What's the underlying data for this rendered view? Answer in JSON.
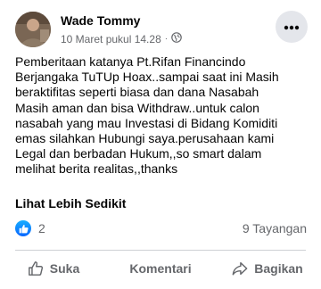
{
  "post": {
    "author": "Wade Tommy",
    "timestamp": "10 Maret pukul 14.28",
    "separator": "·",
    "audience_icon": "globe-icon",
    "more_icon": "more-dots-icon",
    "body": "Pemberitaan katanya Pt.Rifan Financindo\nBerjangaka TuTUp Hoax..sampai saat ini Masih\nberaktifitas seperti biasa dan dana Nasabah\nMasih aman dan bisa Withdraw..untuk calon\nnasabah yang mau Investasi di Bidang Komiditi\nemas silahkan Hubungi saya.perusahaan kami\nLegal dan berbadan Hukum,,so smart dalam\nmelihat berita realitas,,thanks",
    "see_less": "Lihat Lebih Sedikit"
  },
  "stats": {
    "reaction_icon": "like-icon",
    "reaction_count": "2",
    "views": "9 Tayangan"
  },
  "actions": {
    "like": "Suka",
    "comment": "Komentari",
    "share": "Bagikan"
  },
  "colors": {
    "secondary_text": "#65676b",
    "like_blue": "#0866ff",
    "button_bg": "#e4e6eb"
  }
}
